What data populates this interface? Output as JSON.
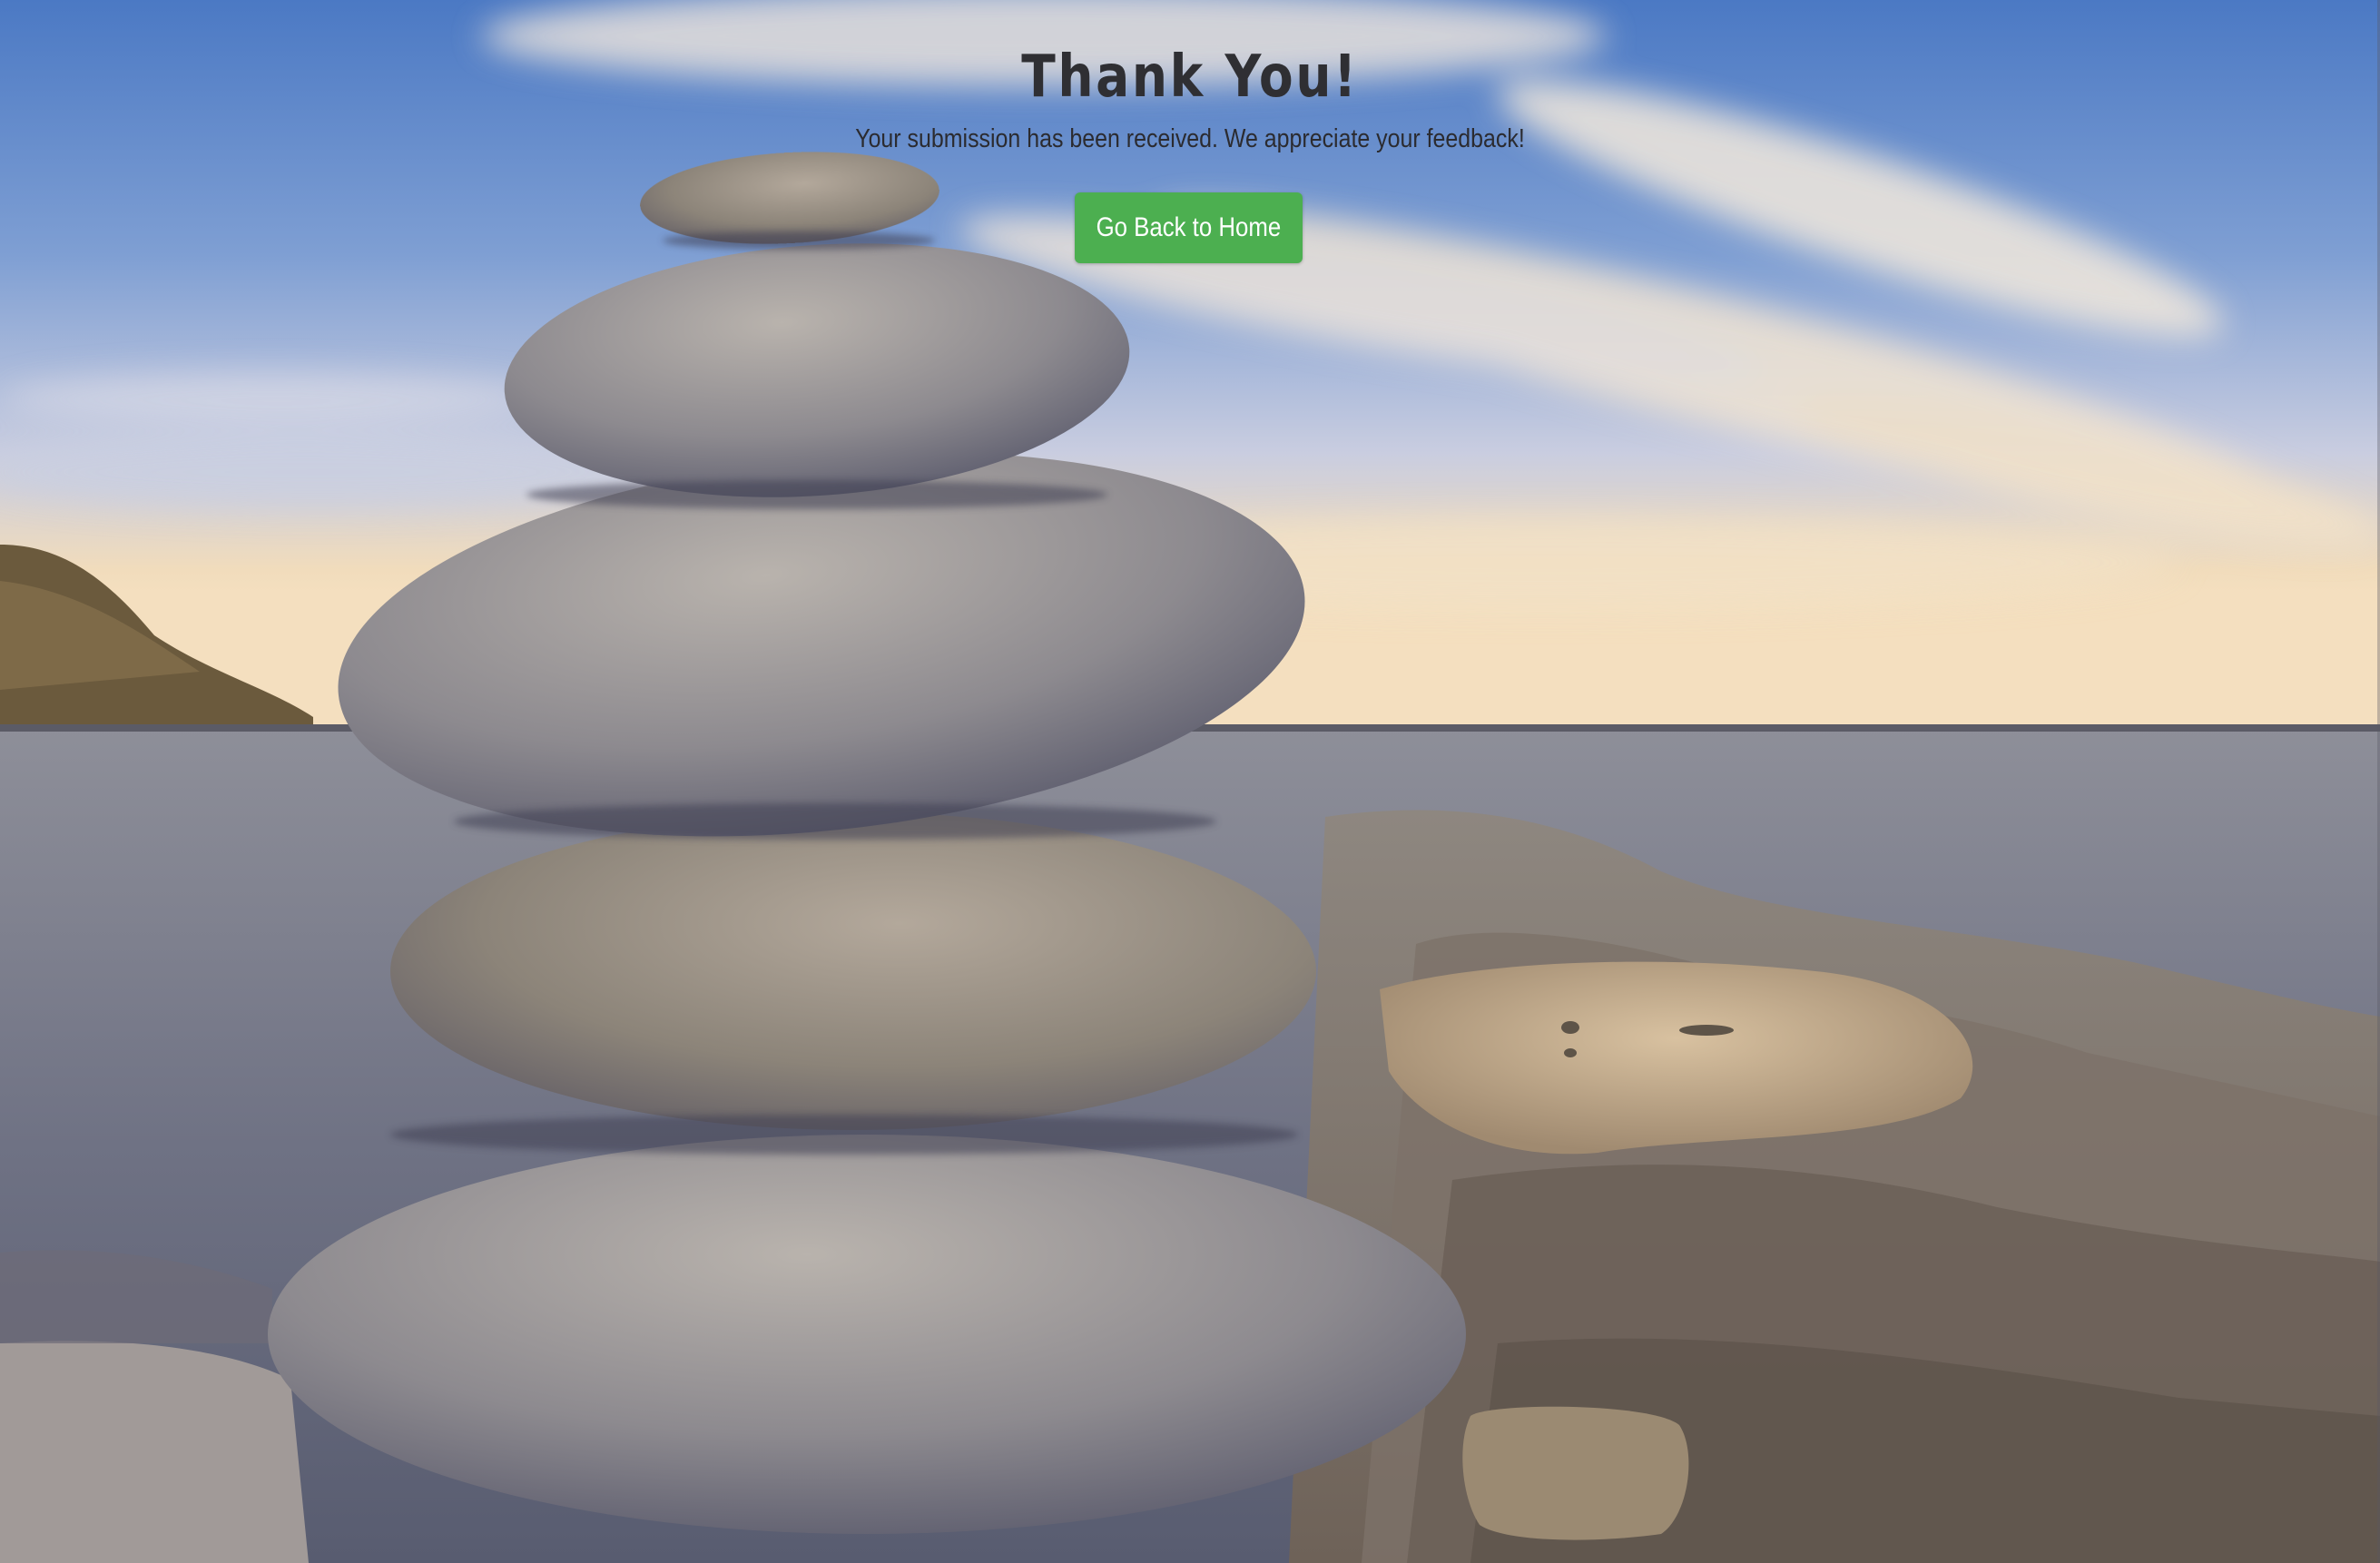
{
  "page": {
    "title": "Thank You!",
    "message": "Your submission has been received. We appreciate your feedback!",
    "button_label": "Go Back to Home"
  },
  "background": {
    "description_icon": "stacked-stones-beach-photo",
    "accent_button_color": "#4caf50"
  }
}
